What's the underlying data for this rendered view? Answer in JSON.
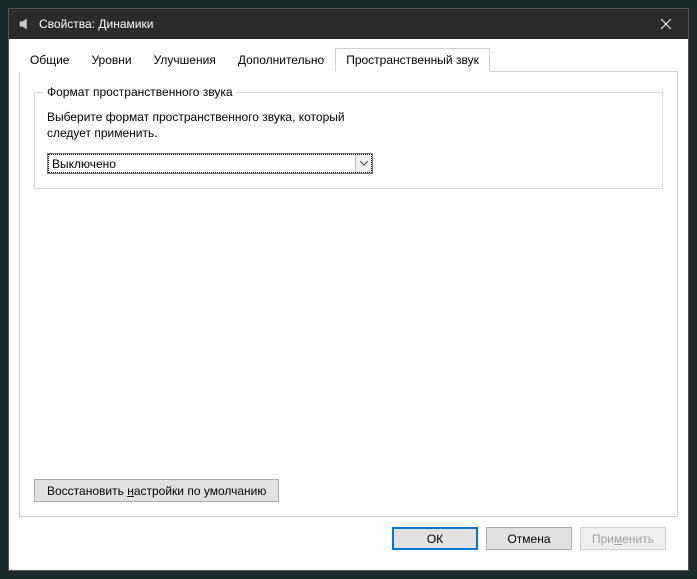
{
  "titlebar": {
    "title": "Свойства: Динамики"
  },
  "tabs": {
    "t0": "Общие",
    "t1": "Уровни",
    "t2": "Улучшения",
    "t3": "Дополнительно",
    "t4": "Пространственный звук"
  },
  "group": {
    "title": "Формат пространственного звука",
    "desc": "Выберите формат пространственного звука, который следует применить.",
    "selected": "Выключено"
  },
  "restore": {
    "prefix": "Восстановить ",
    "underlined": "н",
    "suffix": "астройки по умолчанию"
  },
  "footer": {
    "ok": "ОК",
    "cancel": "Отмена",
    "apply_prefix": "При",
    "apply_underlined": "м",
    "apply_suffix": "енить"
  }
}
